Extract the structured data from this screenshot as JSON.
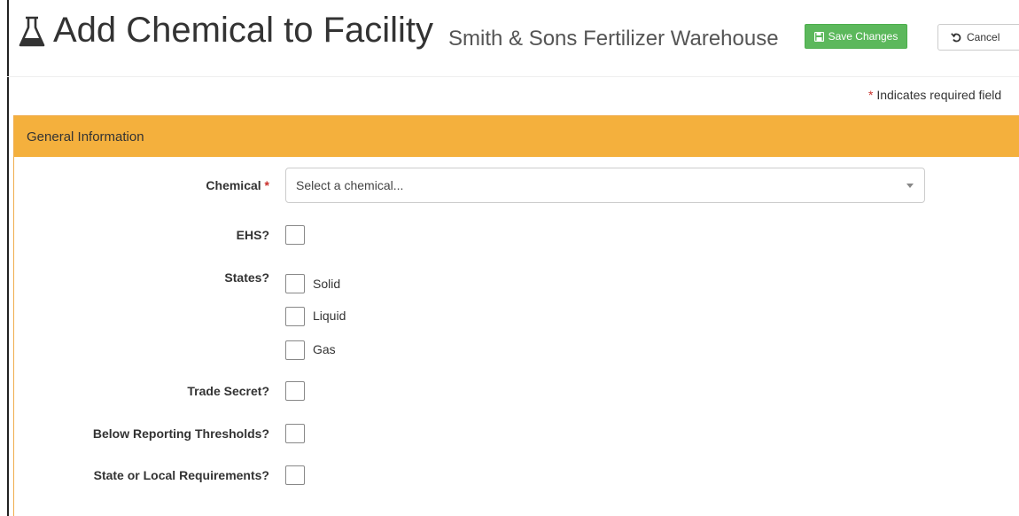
{
  "header": {
    "title": "Add Chemical to Facility",
    "subtitle": "Smith & Sons Fertilizer Warehouse",
    "save_label": "Save Changes",
    "cancel_label": "Cancel",
    "title_icon": "flask-icon",
    "save_icon": "floppy-disk-icon",
    "cancel_icon": "undo-icon"
  },
  "required_note": {
    "star": "*",
    "text": " Indicates required field"
  },
  "panel": {
    "heading": "General Information",
    "accent_color": "#f4b03d"
  },
  "form": {
    "chemical": {
      "label": "Chemical",
      "required_star": "*",
      "placeholder": "Select a chemical..."
    },
    "ehs": {
      "label": "EHS?"
    },
    "states": {
      "label": "States?",
      "options": [
        "Solid",
        "Liquid",
        "Gas"
      ]
    },
    "trade_secret": {
      "label": "Trade Secret?"
    },
    "below_thresholds": {
      "label": "Below Reporting Thresholds?"
    },
    "state_local": {
      "label": "State or Local Requirements?"
    }
  }
}
